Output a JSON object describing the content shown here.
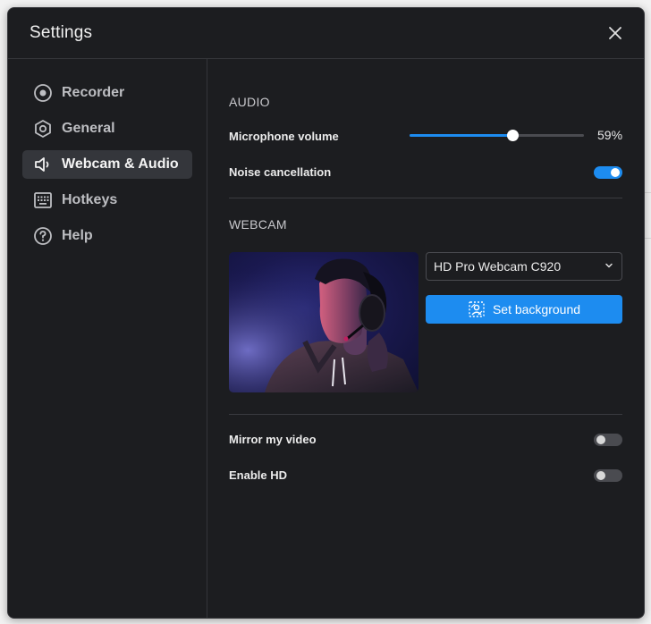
{
  "window": {
    "title": "Settings"
  },
  "sidebar": {
    "items": [
      {
        "label": "Recorder",
        "icon": "record-icon",
        "active": false
      },
      {
        "label": "General",
        "icon": "hexagon-settings-icon",
        "active": false
      },
      {
        "label": "Webcam & Audio",
        "icon": "speaker-icon",
        "active": true
      },
      {
        "label": "Hotkeys",
        "icon": "keyboard-icon",
        "active": false
      },
      {
        "label": "Help",
        "icon": "help-circle-icon",
        "active": false
      }
    ]
  },
  "audio": {
    "heading": "AUDIO",
    "mic_label": "Microphone volume",
    "mic_value": "59%",
    "mic_level": 0.59,
    "noise_label": "Noise cancellation",
    "noise_on": true
  },
  "webcam": {
    "heading": "WEBCAM",
    "device": "HD Pro Webcam C920",
    "background_button": "Set background",
    "mirror_label": "Mirror my video",
    "mirror_on": false,
    "hd_label": "Enable HD",
    "hd_on": false
  },
  "colors": {
    "accent": "#1d8cf0",
    "panel": "#1c1d20",
    "active_nav": "#34363b"
  }
}
